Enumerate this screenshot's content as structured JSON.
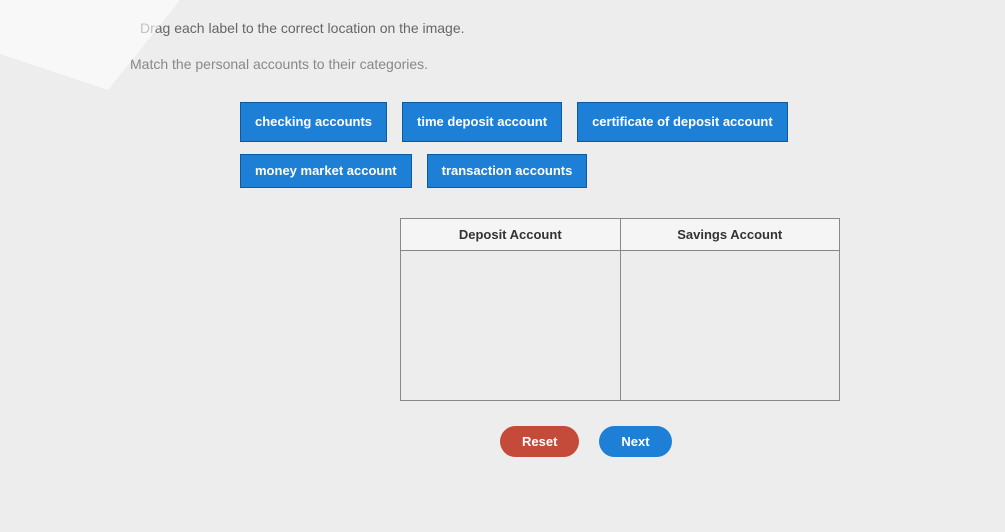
{
  "instructions": {
    "line1": "Drag each label to the correct location on the image.",
    "line2": "Match the personal accounts to their categories."
  },
  "labels": {
    "row1": [
      "checking accounts",
      "time deposit account",
      "certificate of deposit account"
    ],
    "row2": [
      "money market account",
      "transaction accounts"
    ]
  },
  "table": {
    "col1": "Deposit Account",
    "col2": "Savings Account"
  },
  "buttons": {
    "reset": "Reset",
    "next": "Next"
  }
}
